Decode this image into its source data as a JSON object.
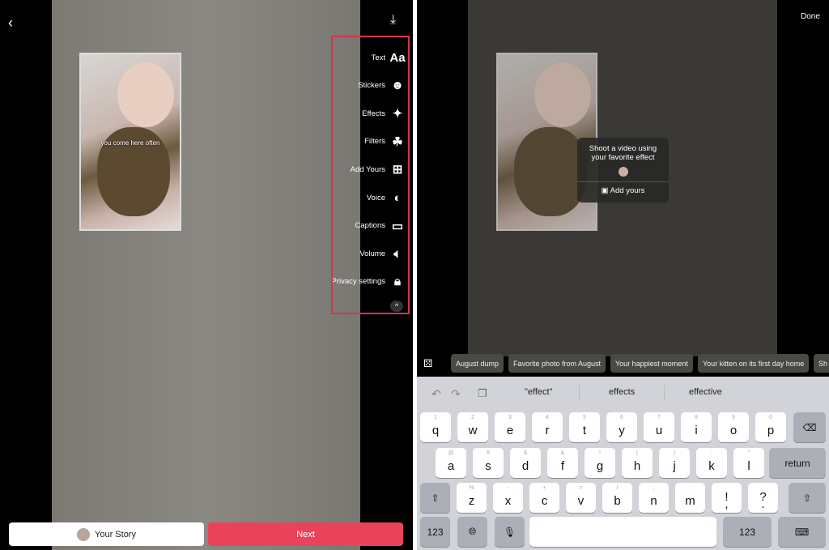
{
  "left": {
    "overlay_caption": "you come here often",
    "tools": [
      {
        "label": "Text",
        "icon": "text-aa-icon"
      },
      {
        "label": "Stickers",
        "icon": "sticker-icon"
      },
      {
        "label": "Effects",
        "icon": "effects-sparkle-icon"
      },
      {
        "label": "Filters",
        "icon": "filters-circles-icon"
      },
      {
        "label": "Add Yours",
        "icon": "add-yours-plus-icon"
      },
      {
        "label": "Voice",
        "icon": "voice-icon"
      },
      {
        "label": "Captions",
        "icon": "captions-icon"
      },
      {
        "label": "Volume",
        "icon": "volume-icon"
      },
      {
        "label": "Privacy settings",
        "icon": "lock-icon"
      }
    ],
    "your_story": "Your Story",
    "next": "Next",
    "highlight_color": "#d8334a",
    "next_color": "#ea4359"
  },
  "right": {
    "done": "Done",
    "card": {
      "prompt": "Shoot a video using your favorite effect",
      "action": "Add yours"
    },
    "chips": [
      "August dump",
      "Favorite photo from August",
      "Your happiest moment",
      "Your kitten on its first day home",
      "Sh"
    ],
    "suggestions": [
      "\"effect\"",
      "effects",
      "effective"
    ],
    "keyboard": {
      "row1": [
        [
          "q",
          "1"
        ],
        [
          "w",
          "2"
        ],
        [
          "e",
          "3"
        ],
        [
          "r",
          "4"
        ],
        [
          "t",
          "5"
        ],
        [
          "y",
          "6"
        ],
        [
          "u",
          "7"
        ],
        [
          "i",
          "8"
        ],
        [
          "o",
          "9"
        ],
        [
          "p",
          "0"
        ]
      ],
      "row2": [
        [
          "a",
          "@"
        ],
        [
          "s",
          "#"
        ],
        [
          "d",
          "$"
        ],
        [
          "f",
          "&"
        ],
        [
          "g",
          "*"
        ],
        [
          "h",
          "("
        ],
        [
          "j",
          ")"
        ],
        [
          "k",
          "'"
        ],
        [
          "l",
          "\""
        ]
      ],
      "row3": [
        [
          "z",
          "%"
        ],
        [
          "x",
          "-"
        ],
        [
          "c",
          "+"
        ],
        [
          "v",
          "="
        ],
        [
          "b",
          "/"
        ],
        [
          "n",
          ";"
        ],
        [
          "m",
          ":"
        ],
        [
          "!\n,",
          ""
        ],
        [
          "?\n.",
          ""
        ]
      ],
      "return": "return",
      "num": "123"
    }
  }
}
